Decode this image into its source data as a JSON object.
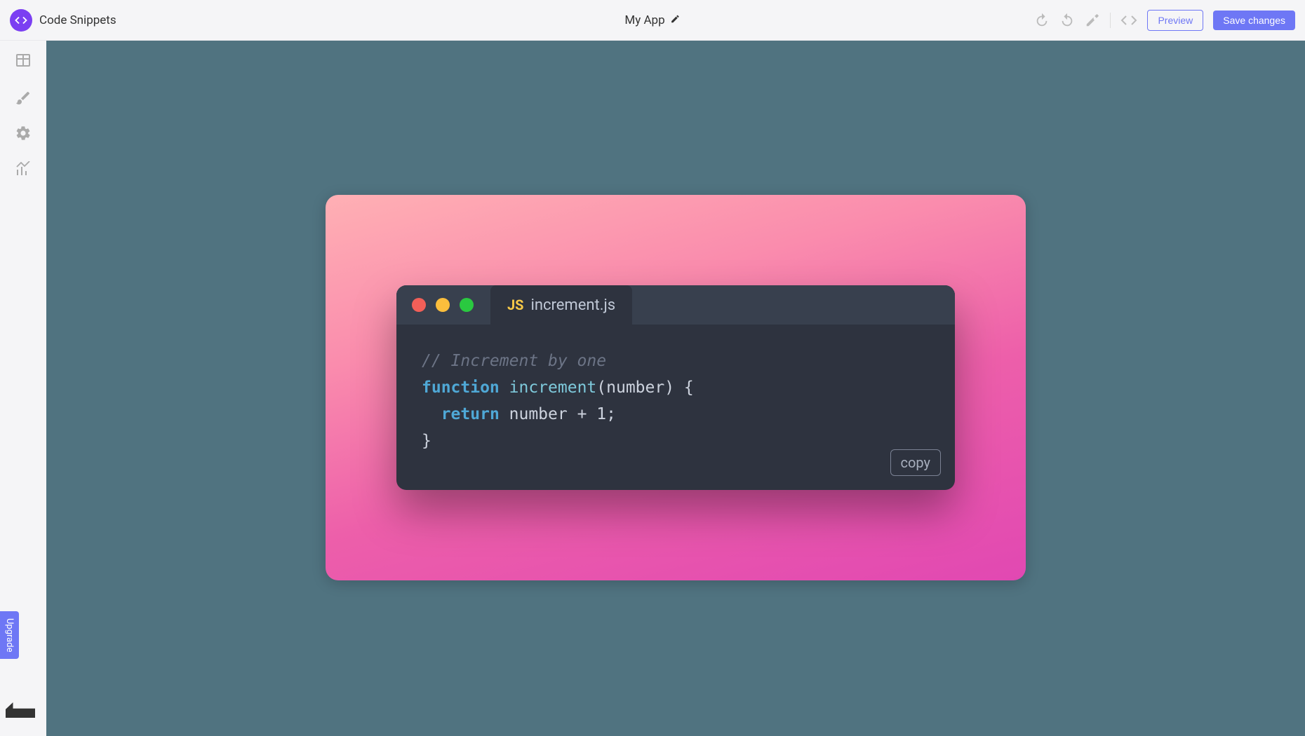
{
  "header": {
    "page_title": "Code Snippets",
    "app_name": "My App",
    "preview_label": "Preview",
    "save_label": "Save changes"
  },
  "sidebar": {
    "upgrade_label": "Upgrade"
  },
  "snippet": {
    "filename": "increment.js",
    "lang_badge": "JS",
    "copy_label": "copy",
    "code": {
      "comment": "// Increment by one",
      "kw_function": "function",
      "fn_name": "increment",
      "paren_open": "(",
      "param": "number",
      "paren_close": ")",
      "brace_open": " {",
      "kw_return": "return",
      "expr_left": " number ",
      "op": "+",
      "space": " ",
      "literal": "1",
      "semicolon": ";",
      "brace_close": "}"
    }
  }
}
